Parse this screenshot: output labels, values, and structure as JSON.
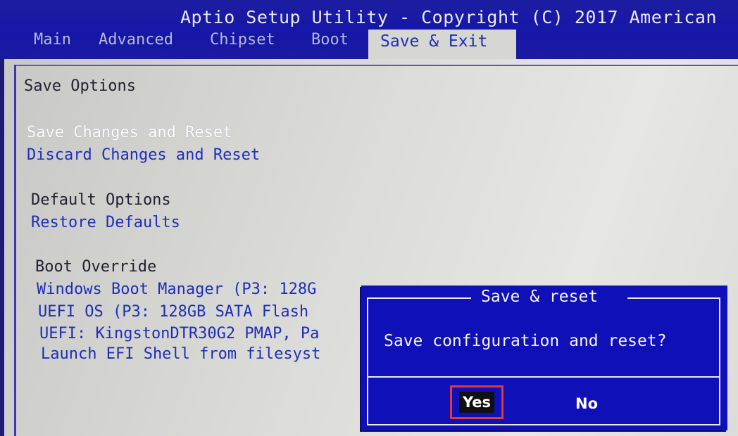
{
  "header": {
    "title": "Aptio Setup Utility - Copyright (C) 2017 American",
    "tabs": [
      {
        "label": "Main"
      },
      {
        "label": "Advanced"
      },
      {
        "label": "Chipset"
      },
      {
        "label": "Boot"
      },
      {
        "label": "Save & Exit"
      }
    ],
    "active_tab": "Save & Exit"
  },
  "menu": {
    "save_options_heading": "Save Options",
    "save_changes_and_reset": "Save Changes and Reset",
    "discard_changes_and_reset": "Discard Changes and Reset",
    "default_options_heading": "Default Options",
    "restore_defaults": "Restore Defaults",
    "boot_override_heading": "Boot Override",
    "boot_override_items": [
      "Windows Boot Manager (P3: 128G",
      "UEFI OS (P3: 128GB SATA Flash",
      "UEFI: KingstonDTR30G2 PMAP, Pa",
      "Launch EFI Shell from filesyst"
    ],
    "selected_item": "Save Changes and Reset"
  },
  "dialog": {
    "title": "Save & reset",
    "message": "Save configuration and reset?",
    "yes_label": "Yes",
    "no_label": "No",
    "highlighted_button": "Yes"
  },
  "colors": {
    "bios_blue": "#1616a8",
    "menu_background": "#d9d9d6",
    "option_text": "#1f2eb8",
    "highlight_border": "#e0383f"
  }
}
